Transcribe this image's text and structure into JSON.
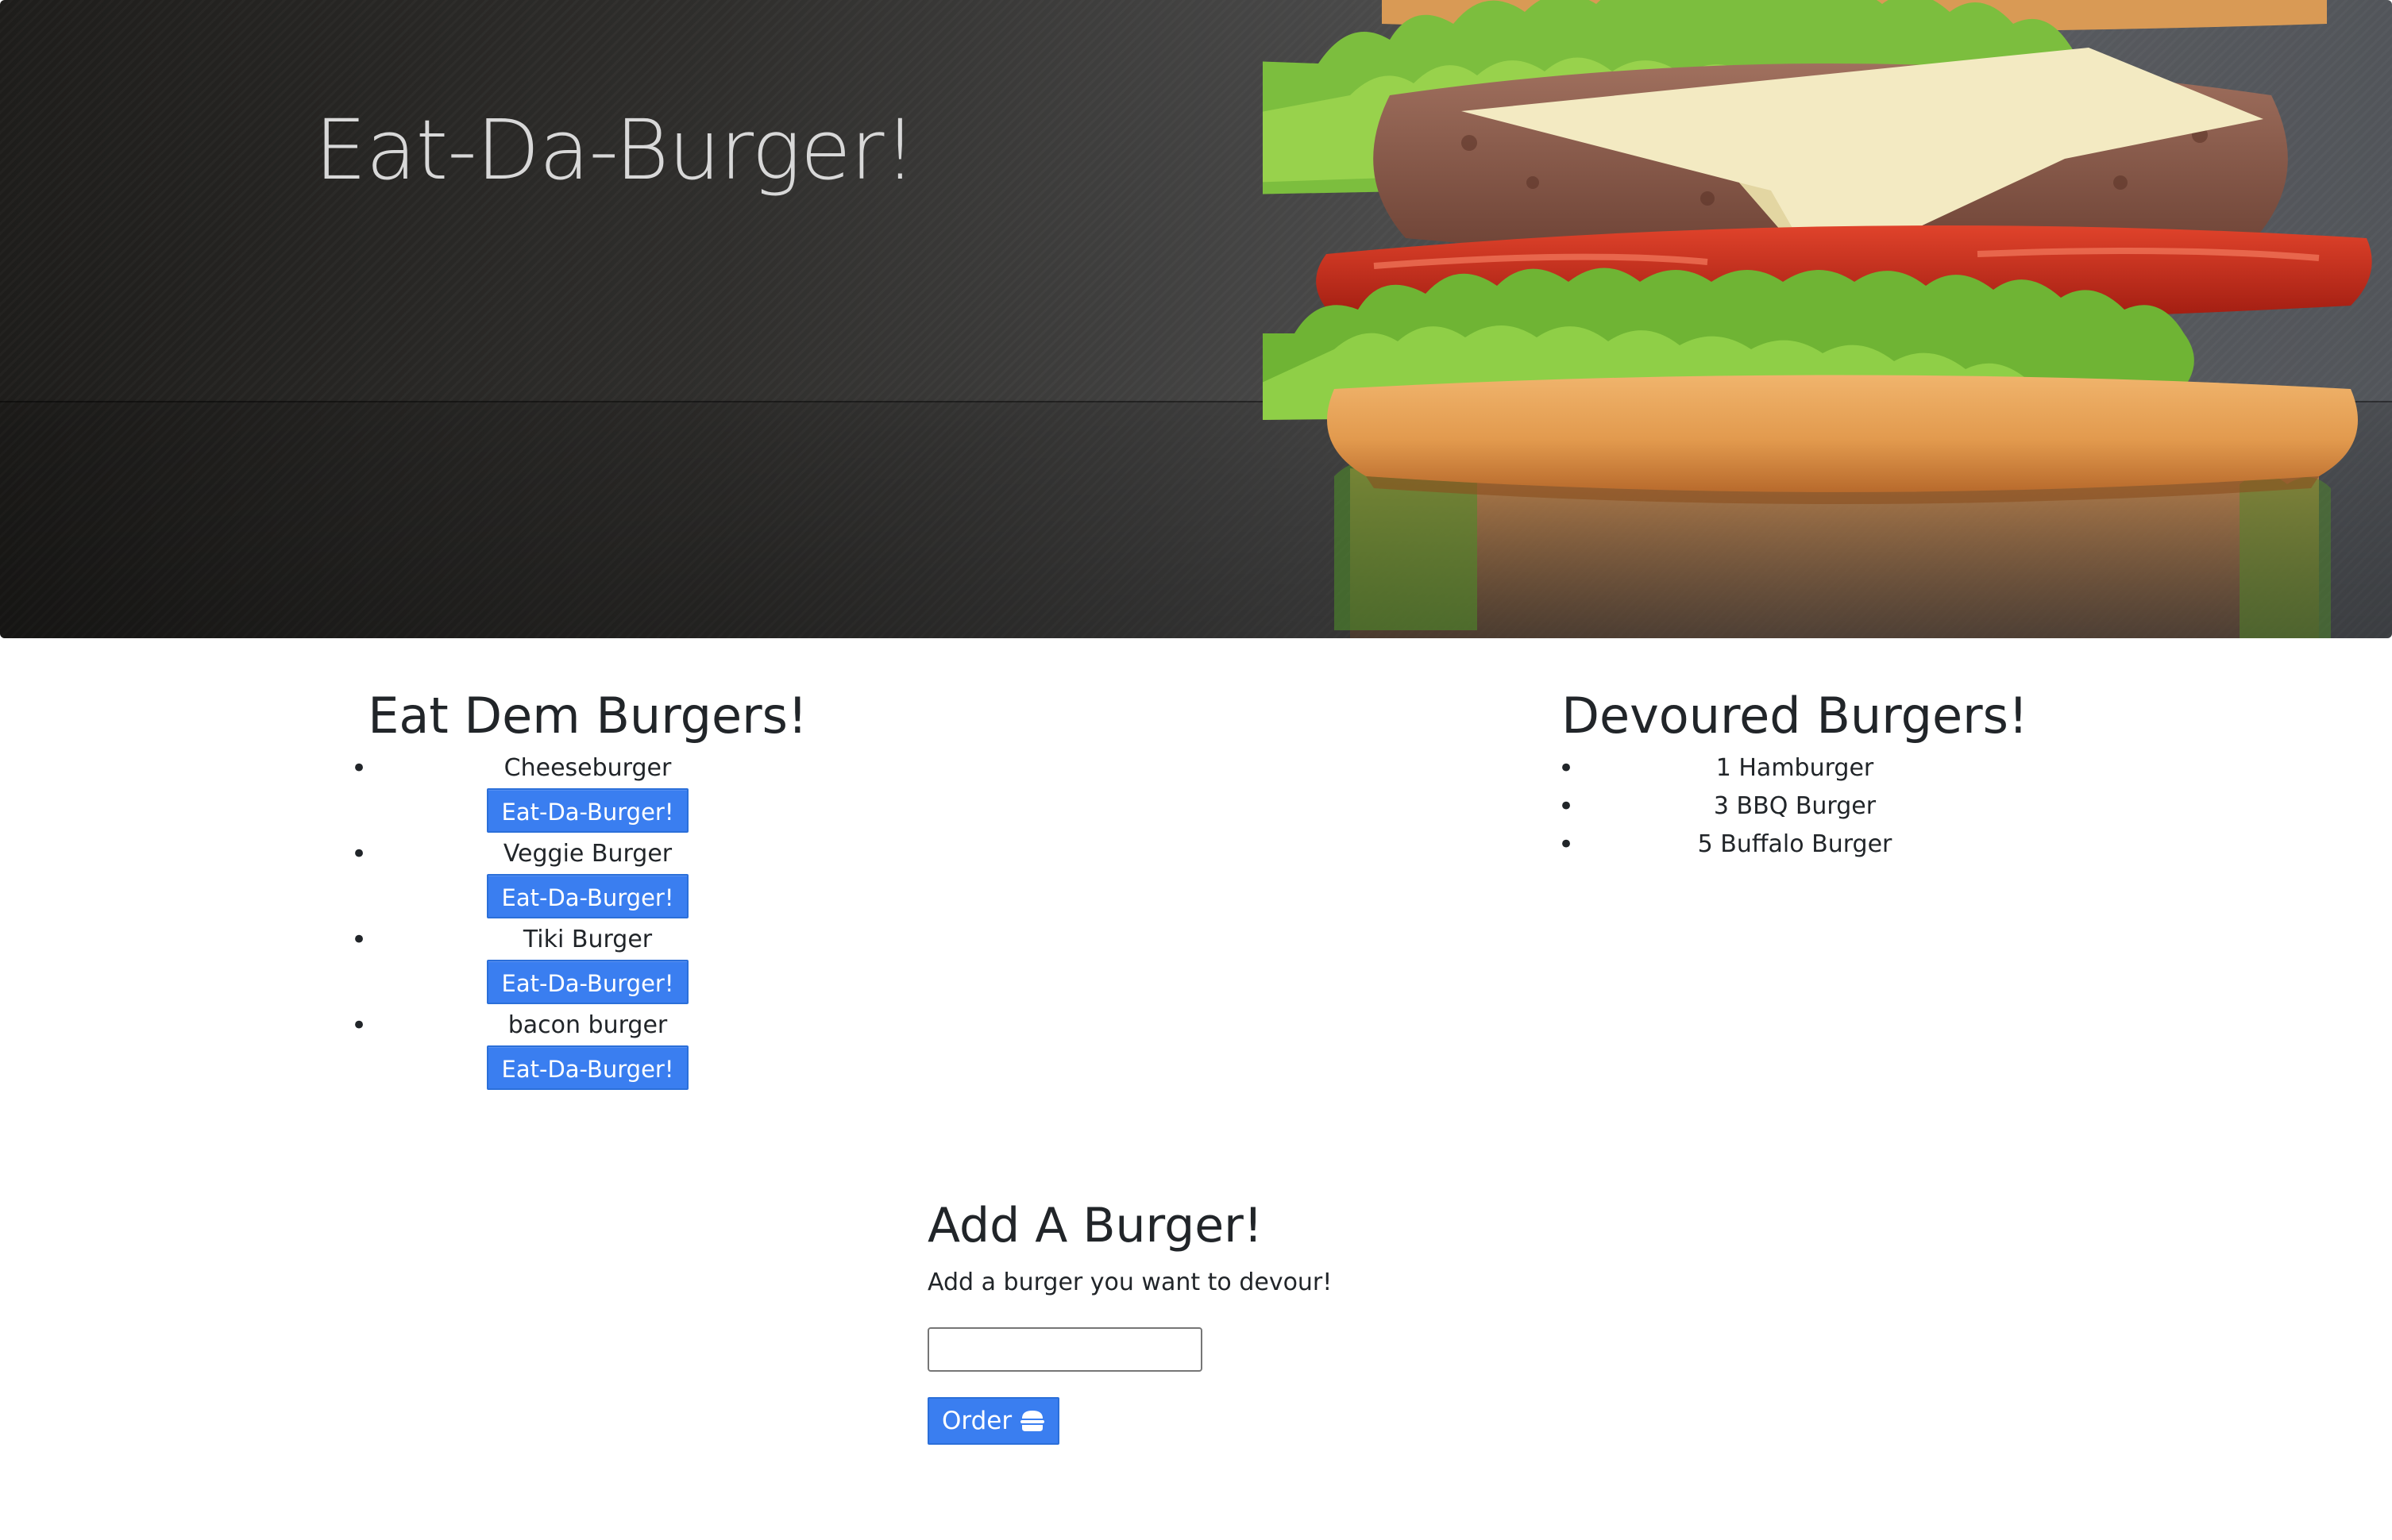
{
  "hero": {
    "title": "Eat-Da-Burger!"
  },
  "to_eat": {
    "heading": "Eat Dem Burgers!",
    "items": [
      {
        "name": "Cheeseburger",
        "button_label": "Eat-Da-Burger!"
      },
      {
        "name": "Veggie Burger",
        "button_label": "Eat-Da-Burger!"
      },
      {
        "name": "Tiki Burger",
        "button_label": "Eat-Da-Burger!"
      },
      {
        "name": "bacon burger",
        "button_label": "Eat-Da-Burger!"
      }
    ]
  },
  "devoured": {
    "heading": "Devoured Burgers!",
    "items": [
      {
        "name": "1 Hamburger"
      },
      {
        "name": "3 BBQ Burger"
      },
      {
        "name": "5 Buffalo Burger"
      }
    ]
  },
  "add_form": {
    "heading": "Add A Burger!",
    "description": "Add a burger you want to devour!",
    "input_value": "",
    "order_label": "Order",
    "order_icon": "hamburger-icon"
  },
  "colors": {
    "button_primary": "#3a7ef0",
    "text": "#212529",
    "hero_title": "#d8d8d8"
  }
}
